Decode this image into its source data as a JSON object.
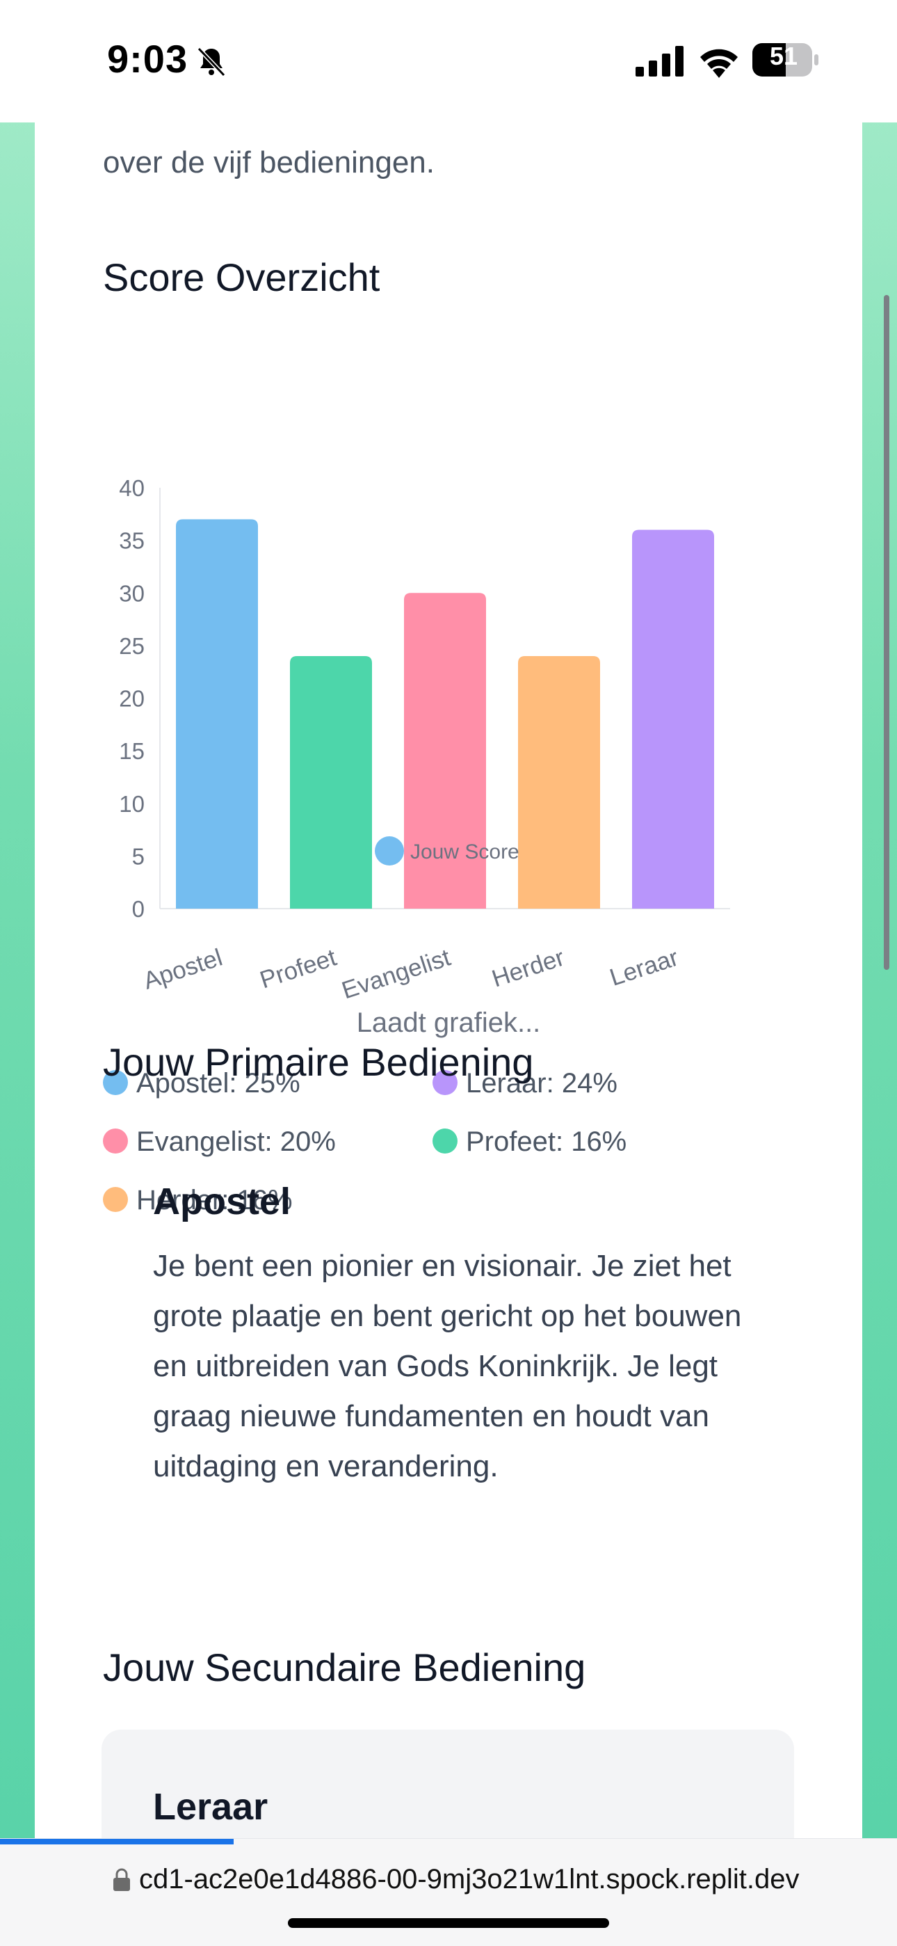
{
  "status_bar": {
    "time": "9:03",
    "battery": "51"
  },
  "intro": {
    "text": "over de vijf bedieningen."
  },
  "score_section": {
    "title": "Score Overzicht"
  },
  "chart_data": {
    "type": "bar",
    "categories": [
      "Apostel",
      "Profeet",
      "Evangelist",
      "Herder",
      "Leraar"
    ],
    "series": [
      {
        "name": "Jouw Score",
        "values": [
          37,
          24,
          30,
          24,
          36
        ]
      }
    ],
    "colors": [
      "#74bdf0",
      "#4dd6aa",
      "#ff8fa8",
      "#ffbc7c",
      "#b895fb"
    ],
    "yticks": [
      "0",
      "5",
      "10",
      "15",
      "20",
      "25",
      "30",
      "35",
      "40"
    ],
    "ylim": [
      0,
      40
    ],
    "legend_position": "bottom"
  },
  "loading": "Laadt grafiek...",
  "percent_legend": [
    {
      "label": "Apostel: 25%",
      "color": "#74bdf0"
    },
    {
      "label": "Leraar: 24%",
      "color": "#b895fb"
    },
    {
      "label": "Evangelist: 20%",
      "color": "#ff8fa8"
    },
    {
      "label": "Profeet: 16%",
      "color": "#4dd6aa"
    },
    {
      "label": "Herder: 16%",
      "color": "#ffbc7c"
    }
  ],
  "primary": {
    "title": "Jouw Primaire Bediening",
    "name": "Apostel",
    "description": "Je bent een pionier en visionair. Je ziet het grote plaatje en bent gericht op het bouwen en uitbreiden van Gods Koninkrijk. Je legt graag nieuwe fundamenten en houdt van uitdaging en verandering."
  },
  "secondary": {
    "title": "Jouw Secundaire Bediening",
    "name": "Leraar"
  },
  "browser": {
    "url": "cd1-ac2e0e1d4886-00-9mj3o21w1lnt.spock.replit.dev"
  }
}
